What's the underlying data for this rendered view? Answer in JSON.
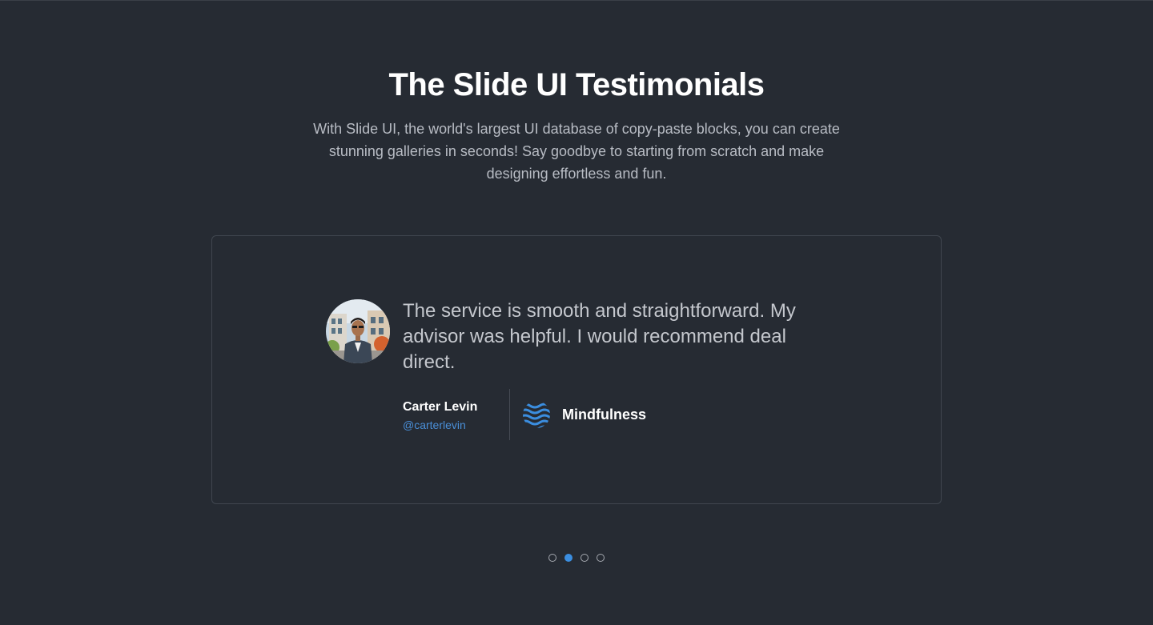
{
  "header": {
    "title": "The Slide UI Testimonials",
    "subtitle": "With Slide UI, the world's largest UI database of copy-paste blocks, you can create stunning galleries in seconds! Say goodbye to starting from scratch and make designing effortless and fun."
  },
  "testimonial": {
    "quote": "The service is smooth and straightforward. My advisor was helpful. I would recommend deal direct.",
    "author_name": "Carter Levin",
    "author_handle": "@carterlevin",
    "company_name": "Mindfulness",
    "company_icon": "waves-logo-icon",
    "avatar_icon": "avatar-photo"
  },
  "carousel": {
    "slide_count": 4,
    "active_index": 1
  },
  "colors": {
    "background": "#262b33",
    "accent": "#3b8ee0",
    "text_primary": "#ffffff",
    "text_secondary": "#b8bcc4"
  }
}
